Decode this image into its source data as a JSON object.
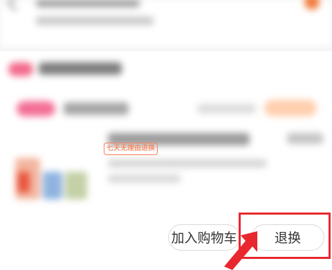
{
  "order": {
    "return_policy_tag": "七天无理由退换"
  },
  "actions": {
    "add_to_cart_label": "加入购物车",
    "return_exchange_label": "退换"
  },
  "colors": {
    "highlight": "#e8272e",
    "tag_accent": "#ff6d3a",
    "brand_pink": "#f26a8c",
    "brand_orange": "#f07a3a"
  }
}
